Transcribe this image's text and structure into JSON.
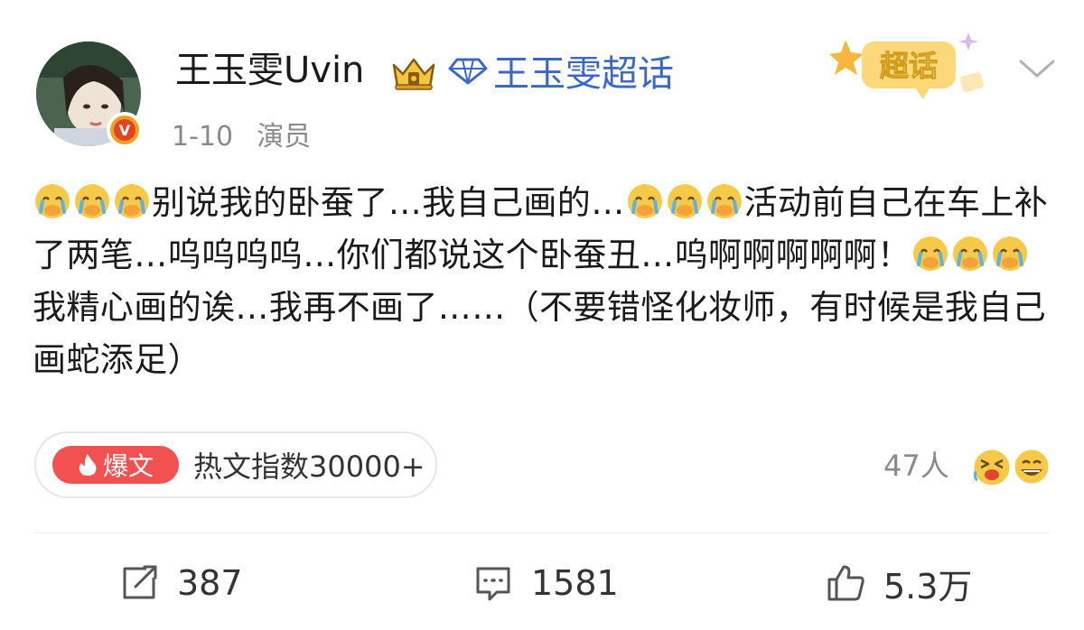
{
  "post": {
    "username": "王玉雯Uvin",
    "supertopic_link": "王玉雯超话",
    "date": "1-10",
    "role": "演员",
    "supertopic_badge": "超话",
    "segments": [
      "别说我的卧蚕了…我自己画的…",
      "活动前自己在车上补了两笔…呜呜呜呜…你们都说这个卧蚕丑…呜啊啊啊啊啊！",
      "我精心画的诶…我再不画了……（不要错怪化妆师，有时候是我自己画蛇添足）"
    ]
  },
  "hot": {
    "badge_label": "爆文",
    "text": "热文指数30000+"
  },
  "reactions": {
    "people": "47人"
  },
  "actions": {
    "share_count": "387",
    "comment_count": "1581",
    "like_count": "5.3万"
  },
  "colors": {
    "link": "#3b68c4",
    "hot_badge": "#f25151",
    "secondary_text": "#8a8a8a"
  }
}
